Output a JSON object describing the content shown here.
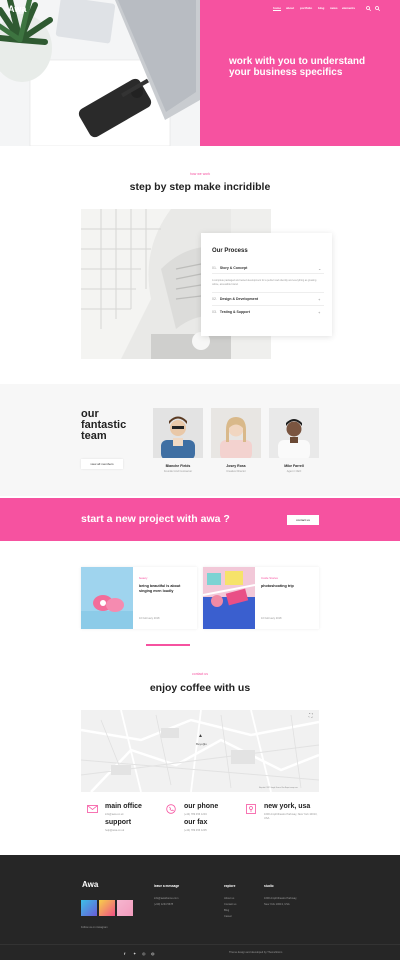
{
  "brand": {
    "logo": "Awa",
    "accent": "#f652a0"
  },
  "nav": [
    "home",
    "about",
    "portfolio",
    "blog",
    "news",
    "elements"
  ],
  "hero": {
    "headline": "work with you to understand your business specifics"
  },
  "process": {
    "kicker": "how we work",
    "title": "step by step make incridible",
    "card_title": "Our Process",
    "items": [
      {
        "num": "01.",
        "label": "Story & Concept",
        "open": true
      },
      {
        "num": "02.",
        "label": "Design & Development",
        "open": false
      },
      {
        "num": "03.",
        "label": "Testing & Support",
        "open": false
      }
    ],
    "description": "A complete packaged and tested development for a perfect web identity and everything as growing online, accessible brand."
  },
  "team": {
    "title": "our fantastic team",
    "button": "view all members",
    "members": [
      {
        "name": "Blanche Fields",
        "role": "Founder And Ceo/owner"
      },
      {
        "name": "Josey Ross",
        "role": "Creative Director"
      },
      {
        "name": "Mike Farrell",
        "role": "Agent / CEO"
      }
    ]
  },
  "cta": {
    "text": "start a new project with awa ?",
    "button": "contact us"
  },
  "posts": [
    {
      "category": "beauty",
      "title": "being beautiful is about singing even loudly",
      "date": "10 February 2018"
    },
    {
      "category": "Inside Stories",
      "title": "photoshooting trip",
      "date": "10 February 2018"
    }
  ],
  "contact": {
    "kicker": "contact us",
    "title": "enjoy coffee with us",
    "map_credit": "Map data ©2017 Google  Terms of Use  Report a map error",
    "map_label": "Beyoğlu",
    "blocks": [
      {
        "head": "main office",
        "sub": "info@awa.co.uk"
      },
      {
        "head": "support",
        "sub": "help@awa.co.uk"
      },
      {
        "head": "our phone",
        "sub": "(+44) 789 456 1234"
      },
      {
        "head": "our fax",
        "sub": "(+44) 789 456 1235"
      },
      {
        "head": "new york, usa",
        "sub": "1600 Amphitheatre Parkway, New York 10013, USA"
      }
    ]
  },
  "footer": {
    "logo": "Awa",
    "columns": [
      {
        "head": "leave a message",
        "lines": [
          "info@awatheme.com",
          "(+90) 1234 5678"
        ]
      },
      {
        "head": "explore",
        "lines": [
          "About us",
          "Contact us",
          "Blog",
          "Career"
        ]
      },
      {
        "head": "studio",
        "lines": [
          "1600 Amphitheatre Parkway,",
          "New York 10013, USA"
        ]
      }
    ],
    "follow": "Follow us on instagram",
    "copyright": "Theme design and developed by ThemeStorm",
    "social_icons": [
      "facebook-icon",
      "twitter-icon",
      "instagram-icon",
      "dribbble-icon"
    ]
  }
}
